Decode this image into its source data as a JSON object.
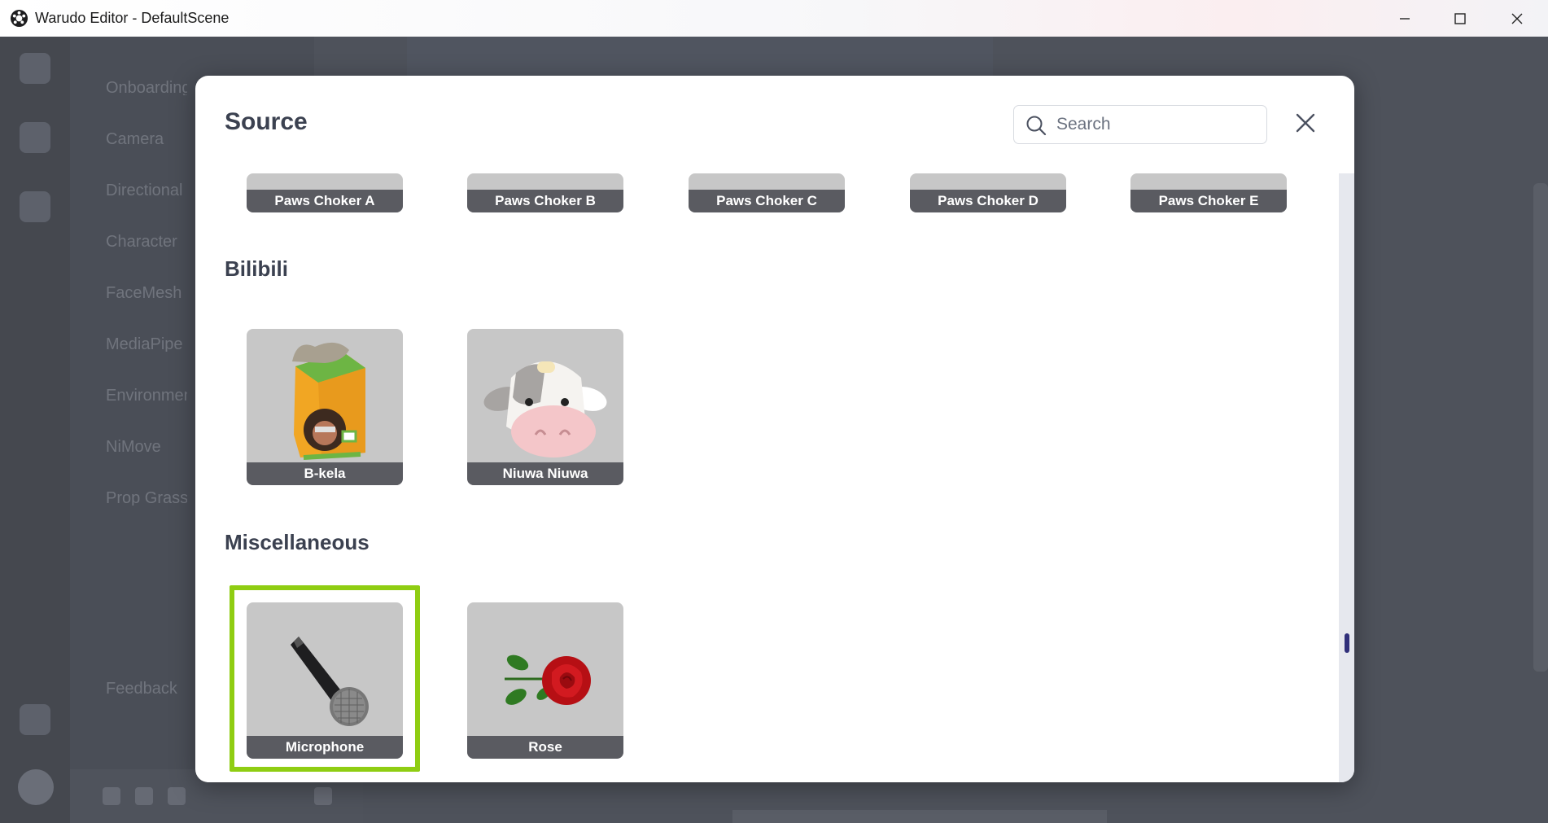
{
  "window": {
    "title": "Warudo Editor - DefaultScene"
  },
  "background": {
    "panel_rows": [
      "Onboarding",
      "Camera",
      "Directional",
      "Character",
      "FaceMesh",
      "MediaPipe",
      "Environment",
      "NiMove",
      "Prop Grass"
    ],
    "bottom_label": "Feedback"
  },
  "modal": {
    "title": "Source",
    "search": {
      "value": "",
      "placeholder": "Search"
    },
    "top_row": [
      "Paws Choker A",
      "Paws Choker B",
      "Paws Choker C",
      "Paws Choker D",
      "Paws Choker E"
    ],
    "sections": [
      {
        "title": "Bilibili",
        "items": [
          "B-kela",
          "Niuwa Niuwa"
        ]
      },
      {
        "title": "Miscellaneous",
        "items": [
          "Microphone",
          "Rose"
        ]
      }
    ],
    "selected_item": "Microphone",
    "highlight_color": "#8fcd12",
    "scroll_position_fraction": 0.78
  },
  "icons": {
    "app": "warudo-logo-icon",
    "minimize": "minimize-icon",
    "maximize": "maximize-icon",
    "close": "close-icon",
    "search": "search-icon",
    "modal_close": "close-icon"
  }
}
